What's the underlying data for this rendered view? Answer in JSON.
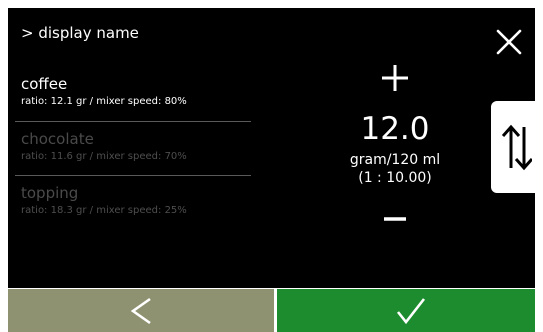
{
  "header": {
    "title": "> display name"
  },
  "products": [
    {
      "name": "coffee",
      "detail": "ratio: 12.1 gr / mixer speed: 80%",
      "active": true
    },
    {
      "name": "chocolate",
      "detail": "ratio: 11.6 gr / mixer speed: 70%",
      "active": false
    },
    {
      "name": "topping",
      "detail": "ratio: 18.3 gr / mixer speed: 25%",
      "active": false
    }
  ],
  "value_panel": {
    "value": "12.0",
    "unit": "gram/120 ml",
    "ratio": "(1 : 10.00)"
  },
  "icons": {
    "close": "close-icon",
    "plus": "plus-icon",
    "minus": "minus-icon",
    "reorder": "swap-vertical-icon",
    "back": "chevron-left-icon",
    "confirm": "checkmark-icon"
  },
  "colors": {
    "background": "#000000",
    "text": "#ffffff",
    "inactive_text": "#4a4a4a",
    "back_button": "#8f9271",
    "confirm_button": "#1d8c2f",
    "reorder_button": "#ffffff"
  }
}
